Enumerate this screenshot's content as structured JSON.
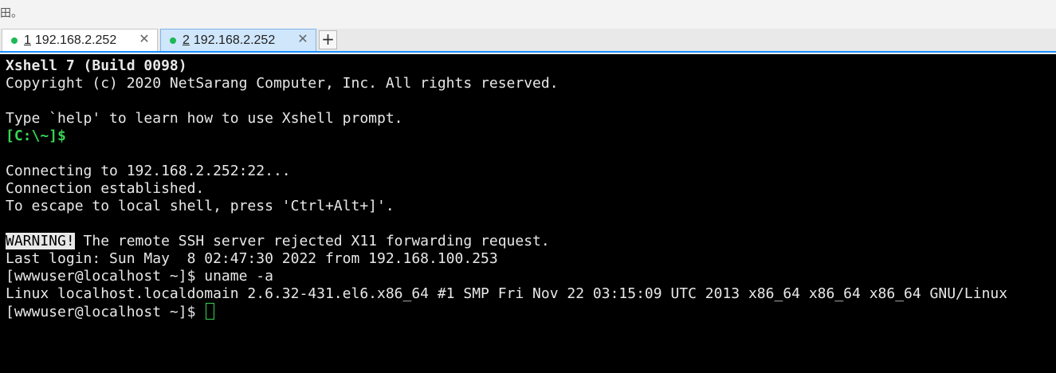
{
  "top_fragment": "田。",
  "tabs": [
    {
      "number": "1",
      "title": "192.168.2.252",
      "close": "✕",
      "active": false
    },
    {
      "number": "2",
      "title": "192.168.2.252",
      "close": "✕",
      "active": true
    }
  ],
  "new_tab_label": "+",
  "terminal": {
    "lines": [
      "Xshell 7 (Build 0098)",
      "Copyright (c) 2020 NetSarang Computer, Inc. All rights reserved.",
      "",
      "Type `help' to learn how to use Xshell prompt.",
      "[C:\\~]$",
      "",
      "Connecting to 192.168.2.252:22...",
      "Connection established.",
      "To escape to local shell, press 'Ctrl+Alt+]'.",
      "",
      "WARNING!",
      " The remote SSH server rejected X11 forwarding request.",
      "Last login: Sun May  8 02:47:30 2022 from 192.168.100.253",
      "[wwwuser@localhost ~]$ uname -a",
      "Linux localhost.localdomain 2.6.32-431.el6.x86_64 #1 SMP Fri Nov 22 03:15:09 UTC 2013 x86_64 x86_64 x86_64 GNU/Linux",
      "[wwwuser@localhost ~]$ "
    ]
  },
  "colors": {
    "terminal_bg": "#000000",
    "terminal_fg": "#e8e8e8",
    "prompt_green": "#39d353",
    "active_tab_bg": "#cfe6fb",
    "tab_underline": "#1e90ff",
    "status_dot": "#1db954"
  }
}
